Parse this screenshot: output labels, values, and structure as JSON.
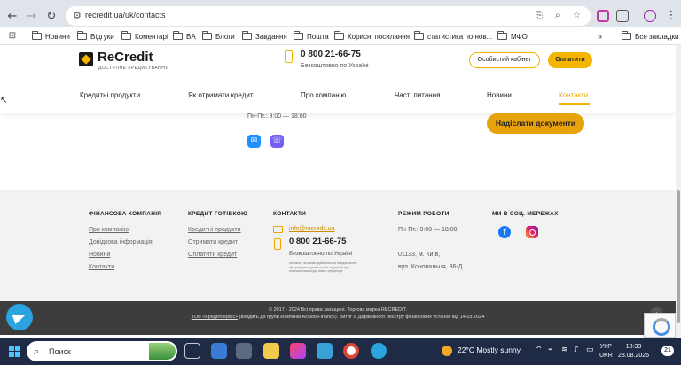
{
  "browser": {
    "url": "recredit.ua/uk/contacts",
    "bookmarks": [
      {
        "label": "Новини"
      },
      {
        "label": "Відгуки"
      },
      {
        "label": "Коментарі"
      },
      {
        "label": "BA"
      },
      {
        "label": "Блоги"
      },
      {
        "label": "Завдання"
      },
      {
        "label": "Пошта"
      },
      {
        "label": "Корисні посилання"
      },
      {
        "label": "статистика по нов..."
      },
      {
        "label": "МФО"
      }
    ],
    "all_bookmarks": "Все закладки"
  },
  "header": {
    "logo_text": "ReCredit",
    "logo_tagline": "ДОСТУПНЕ КРЕДИТУВАННЯ",
    "phone": "0 800 21-66-75",
    "phone_note": "Безкоштовно по Україні",
    "cabinet_button": "Особистий кабінет",
    "pay_button": "Оплатити",
    "nav": [
      {
        "label": "Кредитні продукти"
      },
      {
        "label": "Як отримати кредит"
      },
      {
        "label": "Про компанію"
      },
      {
        "label": "Часті питання"
      },
      {
        "label": "Новини"
      },
      {
        "label": "Контакти"
      }
    ]
  },
  "content": {
    "hours": "Пн-Пт.: 9:00 — 18:00",
    "send_documents_button": "Надіслати документи"
  },
  "footer": {
    "col1": {
      "heading": "ФІНАНСОВА КОМПАНІЯ",
      "links": [
        "Про компанію",
        "Довідкова інформація",
        "Новини",
        "Контакти"
      ]
    },
    "col2": {
      "heading": "КРЕДИТ ГОТІВКОЮ",
      "links": [
        "Кредитні продукти",
        "Отримати кредит",
        "Оплатити кредит"
      ]
    },
    "col3": {
      "heading": "КОНТАКТИ",
      "email": "info@recredit.ua",
      "phone": "0 800 21-66-75",
      "phone_note": "Безкоштовно по Україні",
      "small_note": "контакти, за якими здійснюється повідомлення про розкриття даних особи, відомості про позичальника щодо вимог кредитора"
    },
    "col4": {
      "heading": "РЕЖИМ РОБОТИ",
      "hours": "Пн-Пт.: 9:00 — 18:00",
      "address_line1": "01133, м. Київ,",
      "address_line2": "вул. Коновальця, 36-Д"
    },
    "col5": {
      "heading": "МИ В СОЦ. МЕРЕЖАХ"
    },
    "copyright": "© 2017 - 2024 Всі права захищені. Торгова марка RECREDIT.",
    "legal_link": "ТОВ «Кредитсервіс»",
    "legal_text": " (входить до групи компаній AccessFinance). Витяг із Державного реєстру фінансових установ від 14.03.2024"
  },
  "taskbar": {
    "search_placeholder": "Поиск",
    "weather": "22°C  Mostly sunny",
    "lang_top": "УКР",
    "lang_bottom": "UKR",
    "time": "18:33",
    "date": "28.08.2026",
    "notifications": "21"
  }
}
